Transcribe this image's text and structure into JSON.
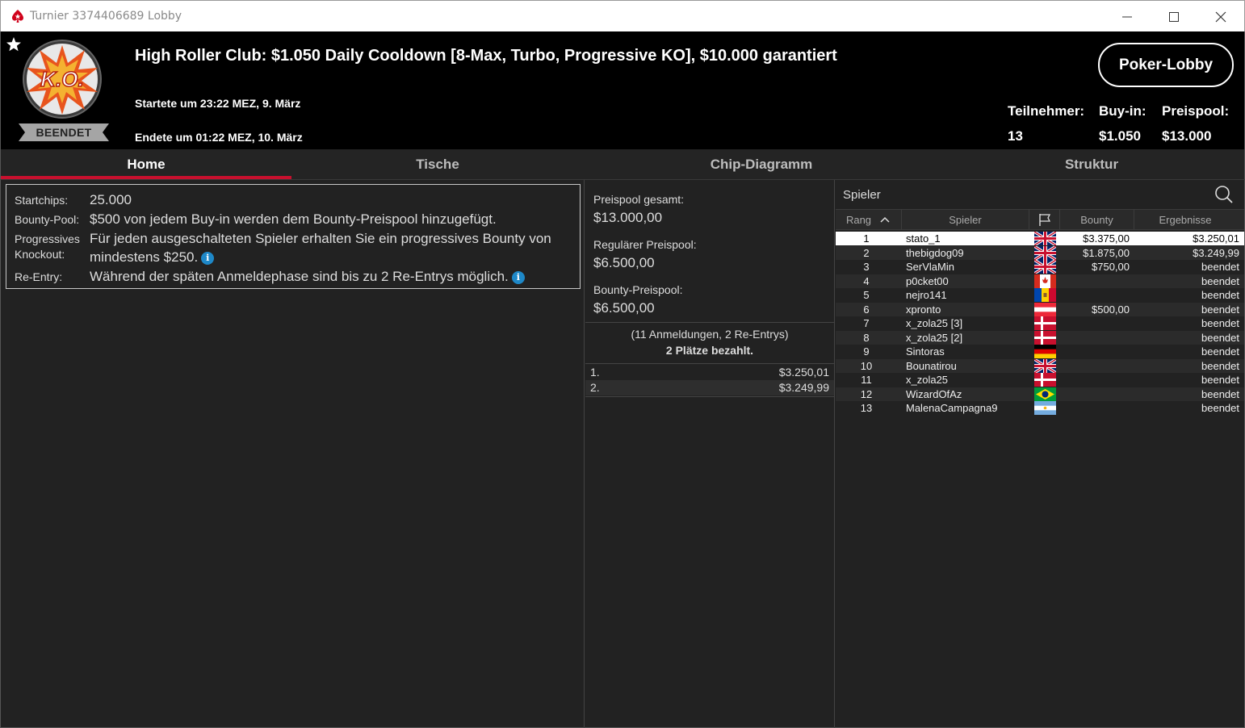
{
  "window": {
    "title": "Turnier 3374406689 Lobby"
  },
  "header": {
    "status": "BEENDET",
    "tournament_title": "High Roller Club: $1.050 Daily Cooldown [8-Max, Turbo, Progressive KO], $10.000 garantiert",
    "started": "Startete um 23:22 MEZ, 9. März",
    "ended": "Endete um 01:22 MEZ, 10. März",
    "lobby_button": "Poker-Lobby",
    "stats": {
      "participants_label": "Teilnehmer:",
      "participants_value": "13",
      "buyin_label": "Buy-in:",
      "buyin_value": "$1.050",
      "prizepool_label": "Preispool:",
      "prizepool_value": "$13.000"
    },
    "logo_text": "K.O."
  },
  "tabs": [
    "Home",
    "Tische",
    "Chip-Diagramm",
    "Struktur"
  ],
  "info": {
    "startchips_label": "Startchips:",
    "startchips_value": "25.000",
    "bounty_label": "Bounty-Pool:",
    "bounty_value": "$500 von jedem Buy-in werden dem Bounty-Preispool hinzugefügt.",
    "pko_label_1": "Progressives",
    "pko_label_2": "Knockout:",
    "pko_value_1": "Für jeden ausgeschalteten Spieler erhalten Sie ein progressives Bounty von",
    "pko_value_2": "mindestens $250.",
    "reentry_label": "Re-Entry:",
    "reentry_value": "Während der späten Anmeldephase sind bis zu 2 Re-Entrys möglich."
  },
  "prizepool": {
    "total_label": "Preispool gesamt:",
    "total_value": "$13.000,00",
    "regular_label": "Regulärer Preispool:",
    "regular_value": "$6.500,00",
    "bounty_label": "Bounty-Preispool:",
    "bounty_value": "$6.500,00",
    "entries_note": "(11 Anmeldungen, 2 Re-Entrys)",
    "paid_note": "2 Plätze bezahlt.",
    "payouts": [
      {
        "rank": "1.",
        "amount": "$3.250,01"
      },
      {
        "rank": "2.",
        "amount": "$3.249,99"
      }
    ]
  },
  "players_panel": {
    "search_label": "Spieler",
    "columns": {
      "rank": "Rang",
      "player": "Spieler",
      "bounty": "Bounty",
      "results": "Ergebnisse"
    },
    "rows": [
      {
        "rank": "1",
        "name": "stato_1",
        "flag": "uk",
        "bounty": "$3.375,00",
        "result": "$3.250,01"
      },
      {
        "rank": "2",
        "name": "thebigdog09",
        "flag": "uk",
        "bounty": "$1.875,00",
        "result": "$3.249,99"
      },
      {
        "rank": "3",
        "name": "SerVlaMin",
        "flag": "uk",
        "bounty": "$750,00",
        "result": "beendet"
      },
      {
        "rank": "4",
        "name": "p0cket00",
        "flag": "canada",
        "bounty": "",
        "result": "beendet"
      },
      {
        "rank": "5",
        "name": "nejro141",
        "flag": "moldova",
        "bounty": "",
        "result": "beendet"
      },
      {
        "rank": "6",
        "name": "xpronto",
        "flag": "austria",
        "bounty": "$500,00",
        "result": "beendet"
      },
      {
        "rank": "7",
        "name": "x_zola25 [3]",
        "flag": "denmark",
        "bounty": "",
        "result": "beendet"
      },
      {
        "rank": "8",
        "name": "x_zola25 [2]",
        "flag": "denmark",
        "bounty": "",
        "result": "beendet"
      },
      {
        "rank": "9",
        "name": "Sintoras",
        "flag": "germany",
        "bounty": "",
        "result": "beendet"
      },
      {
        "rank": "10",
        "name": "Bounatirou",
        "flag": "uk",
        "bounty": "",
        "result": "beendet"
      },
      {
        "rank": "11",
        "name": "x_zola25",
        "flag": "denmark",
        "bounty": "",
        "result": "beendet"
      },
      {
        "rank": "12",
        "name": "WizardOfAz",
        "flag": "brazil",
        "bounty": "",
        "result": "beendet"
      },
      {
        "rank": "13",
        "name": "MalenaCampagna9",
        "flag": "argentina",
        "bounty": "",
        "result": "beendet"
      }
    ]
  },
  "colors": {
    "accent_red": "#c8102e",
    "info_blue": "#1e88c8",
    "background": "#222222",
    "header_bg": "#000000"
  }
}
